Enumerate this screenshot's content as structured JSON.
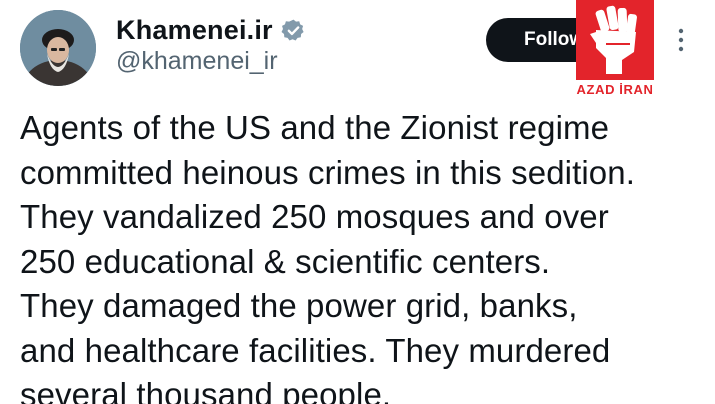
{
  "author": {
    "display_name": "Khamenei.ir",
    "handle": "@khamenei_ir",
    "verified": true
  },
  "follow_button": {
    "label": "Follow"
  },
  "overlay_logo": {
    "text": "AZAD İRAN",
    "color": "#e3242b"
  },
  "icons": {
    "verified": "verified-badge-icon",
    "more": "more-options-icon",
    "logo": "raised-fist-icon"
  },
  "tweet": {
    "lines": [
      "Agents of the US and the Zionist regime",
      "committed heinous crimes in this sedition.",
      "They vandalized 250 mosques and over",
      "250 educational & scientific centers.",
      "They damaged the power grid, banks,",
      "and healthcare facilities. They murdered",
      "several thousand people."
    ]
  },
  "colors": {
    "text_primary": "#0f1419",
    "text_secondary": "#536471",
    "button_bg": "#0f1419",
    "verified_badge": "#829aab"
  }
}
